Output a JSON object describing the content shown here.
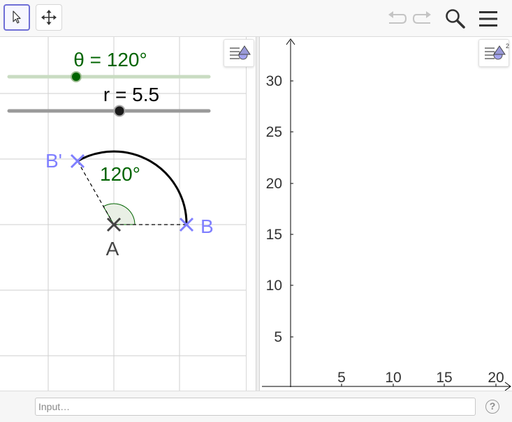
{
  "toolbar": {
    "tools": [
      {
        "name": "move-tool",
        "icon": "cursor-arrow-icon",
        "active": true
      },
      {
        "name": "move-graphics-view-tool",
        "icon": "move-arrows-icon",
        "active": false
      }
    ],
    "actions": [
      "undo-icon",
      "redo-icon",
      "search-icon",
      "menu-icon"
    ]
  },
  "graphics1": {
    "sliders": [
      {
        "label": "θ = 120°",
        "value": 120,
        "min": 0,
        "max": 360,
        "fraction": 0.33,
        "color": "#006400"
      },
      {
        "label": "r = 5.5",
        "value": 5.5,
        "min": 0,
        "max": 10,
        "fraction": 0.55,
        "color": "#000000"
      }
    ],
    "points": [
      {
        "label": "A",
        "color": "#444444"
      },
      {
        "label": "B",
        "color": "#7f7fff"
      },
      {
        "label": "B'",
        "color": "#7f7fff"
      }
    ],
    "angle": {
      "label": "120°",
      "color": "#006400"
    }
  },
  "graphics2": {
    "x_ticks": [
      "5",
      "10",
      "15",
      "20"
    ],
    "y_ticks": [
      "5",
      "10",
      "15",
      "20",
      "25",
      "30"
    ]
  },
  "input": {
    "placeholder": "Input…"
  }
}
